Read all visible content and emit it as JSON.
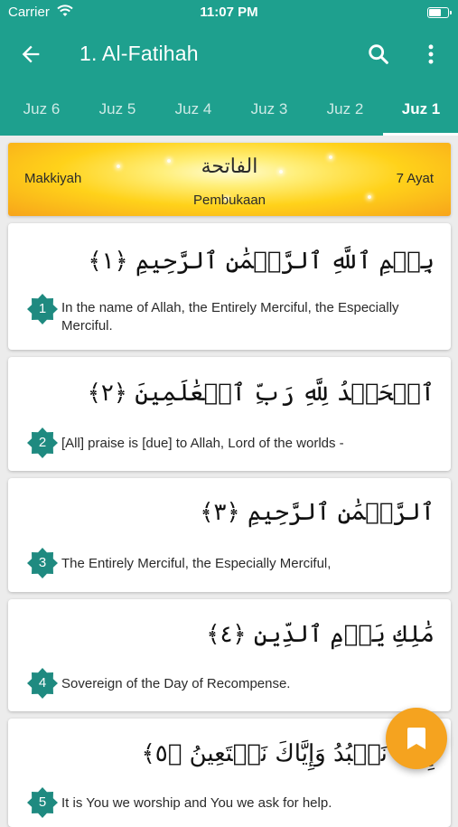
{
  "status_bar": {
    "carrier": "Carrier",
    "time": "11:07 PM"
  },
  "app_bar": {
    "title": "1. Al-Fatihah"
  },
  "tabs": [
    {
      "label": "Juz 6"
    },
    {
      "label": "Juz 5"
    },
    {
      "label": "Juz 4"
    },
    {
      "label": "Juz 3"
    },
    {
      "label": "Juz 2"
    },
    {
      "label": "Juz 1",
      "active": true
    }
  ],
  "banner": {
    "revelation": "Makkiyah",
    "arabic_name": "الفاتحة",
    "meaning": "Pembukaan",
    "ayat_count": "7 Ayat"
  },
  "verses": [
    {
      "number": "1",
      "arabic": "بِسۡمِ ٱللَّهِ ٱلرَّحۡمَٰنِ ٱلرَّحِيمِ ﴿١﴾",
      "translation": "In the name of Allah, the Entirely Merciful, the Especially Merciful."
    },
    {
      "number": "2",
      "arabic": "ٱلۡحَمۡدُ لِلَّهِ رَبِّ ٱلۡعَٰلَمِينَ ﴿٢﴾",
      "translation": "[All] praise is [due] to Allah, Lord of the worlds -"
    },
    {
      "number": "3",
      "arabic": "ٱلرَّحۡمَٰنِ ٱلرَّحِيمِ ﴿٣﴾",
      "translation": "The Entirely Merciful, the Especially Merciful,"
    },
    {
      "number": "4",
      "arabic": "مَٰلِكِ يَوۡمِ ٱلدِّينِ ﴿٤﴾",
      "translation": "Sovereign of the Day of Recompense."
    },
    {
      "number": "5",
      "arabic": "إِيَّاكَ نَعۡبُدُ وَإِيَّاكَ نَسۡتَعِينُ ﴿٥﴾",
      "translation": "It is You we worship and You we ask for help."
    }
  ],
  "icons": {
    "back": "arrow-back-icon",
    "search": "search-icon",
    "more": "more-vert-icon",
    "bookmark": "bookmark-icon"
  },
  "colors": {
    "primary": "#1ea08e",
    "accent": "#f5a31f",
    "verse_badge": "#1f8a80"
  }
}
